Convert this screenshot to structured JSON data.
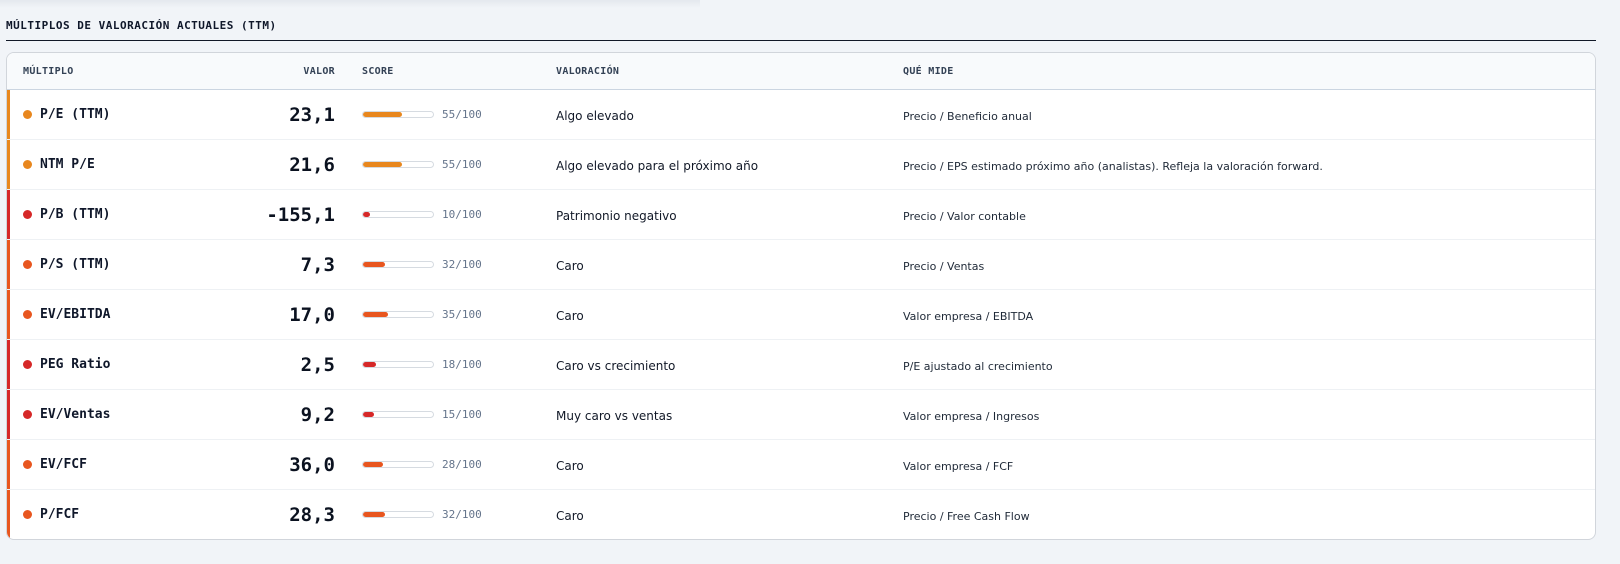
{
  "section": {
    "title": "MÚLTIPLOS DE VALORACIÓN ACTUALES (TTM)"
  },
  "table": {
    "headers": {
      "multiplo": "MÚLTIPLO",
      "valor": "VALOR",
      "score": "SCORE",
      "valoracion": "VALORACIÓN",
      "que_mide": "QUÉ MIDE"
    },
    "colors": {
      "orange": "#e8871e",
      "red_orange": "#e8561f",
      "red": "#d62828"
    },
    "rows": [
      {
        "multiplo": "P/E (TTM)",
        "valor": "23,1",
        "score": 55,
        "score_text": "55/100",
        "valoracion": "Algo elevado",
        "que_mide": "Precio / Beneficio anual",
        "color": "#e8871e"
      },
      {
        "multiplo": "NTM P/E",
        "valor": "21,6",
        "score": 55,
        "score_text": "55/100",
        "valoracion": "Algo elevado para el próximo año",
        "que_mide": "Precio / EPS estimado próximo año (analistas). Refleja la valoración forward.",
        "color": "#e8871e"
      },
      {
        "multiplo": "P/B (TTM)",
        "valor": "-155,1",
        "score": 10,
        "score_text": "10/100",
        "valoracion": "Patrimonio negativo",
        "que_mide": "Precio / Valor contable",
        "color": "#d62828"
      },
      {
        "multiplo": "P/S (TTM)",
        "valor": "7,3",
        "score": 32,
        "score_text": "32/100",
        "valoracion": "Caro",
        "que_mide": "Precio / Ventas",
        "color": "#e8561f"
      },
      {
        "multiplo": "EV/EBITDA",
        "valor": "17,0",
        "score": 35,
        "score_text": "35/100",
        "valoracion": "Caro",
        "que_mide": "Valor empresa / EBITDA",
        "color": "#e8561f"
      },
      {
        "multiplo": "PEG Ratio",
        "valor": "2,5",
        "score": 18,
        "score_text": "18/100",
        "valoracion": "Caro vs crecimiento",
        "que_mide": "P/E ajustado al crecimiento",
        "color": "#d62828"
      },
      {
        "multiplo": "EV/Ventas",
        "valor": "9,2",
        "score": 15,
        "score_text": "15/100",
        "valoracion": "Muy caro vs ventas",
        "que_mide": "Valor empresa / Ingresos",
        "color": "#d62828"
      },
      {
        "multiplo": "EV/FCF",
        "valor": "36,0",
        "score": 28,
        "score_text": "28/100",
        "valoracion": "Caro",
        "que_mide": "Valor empresa / FCF",
        "color": "#e8561f"
      },
      {
        "multiplo": "P/FCF",
        "valor": "28,3",
        "score": 32,
        "score_text": "32/100",
        "valoracion": "Caro",
        "que_mide": "Precio / Free Cash Flow",
        "color": "#e8561f"
      }
    ]
  }
}
